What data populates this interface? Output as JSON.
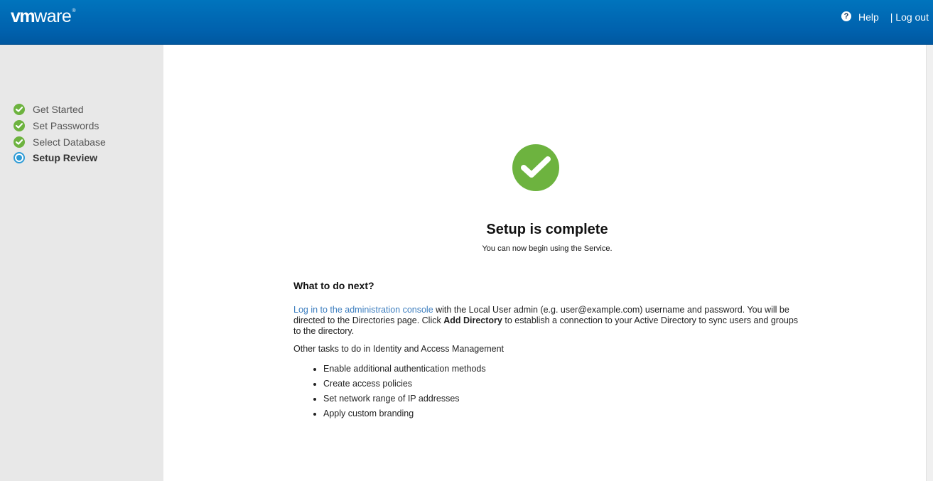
{
  "header": {
    "logo_vm": "vm",
    "logo_ware": "ware",
    "logo_reg": "®",
    "help_icon": "?",
    "help_label": "Help",
    "logout_label": "| Log out"
  },
  "sidebar": {
    "steps": [
      {
        "label": "Get Started",
        "status": "complete",
        "icon": "check-circle-icon"
      },
      {
        "label": "Set Passwords",
        "status": "complete",
        "icon": "check-circle-icon"
      },
      {
        "label": "Select Database",
        "status": "complete",
        "icon": "check-circle-icon"
      },
      {
        "label": "Setup Review",
        "status": "current",
        "icon": "radio-current-icon"
      }
    ]
  },
  "main": {
    "success_icon": "checkmark-icon",
    "title": "Setup is complete",
    "subtitle": "You can now begin using the Service.",
    "next_heading": "What to do next?",
    "para_link": "Log in to the administration console",
    "para_text1": " with the Local User admin (e.g. user@example.com) username and password. You will be directed to the Directories page. Click ",
    "para_bold": "Add Directory",
    "para_text2": " to establish a connection to your Active Directory to sync users and groups to the directory.",
    "other_tasks": "Other tasks to do in Identity and Access Management",
    "tasks": [
      "Enable additional authentication methods",
      "Create access policies",
      "Set network range of IP addresses",
      "Apply custom branding"
    ]
  },
  "colors": {
    "header_blue": "#0066b3",
    "success_green": "#6db33f",
    "current_blue": "#2d9bd6",
    "link_blue": "#3d7ebf",
    "sidebar_bg": "#e8e8e8"
  }
}
